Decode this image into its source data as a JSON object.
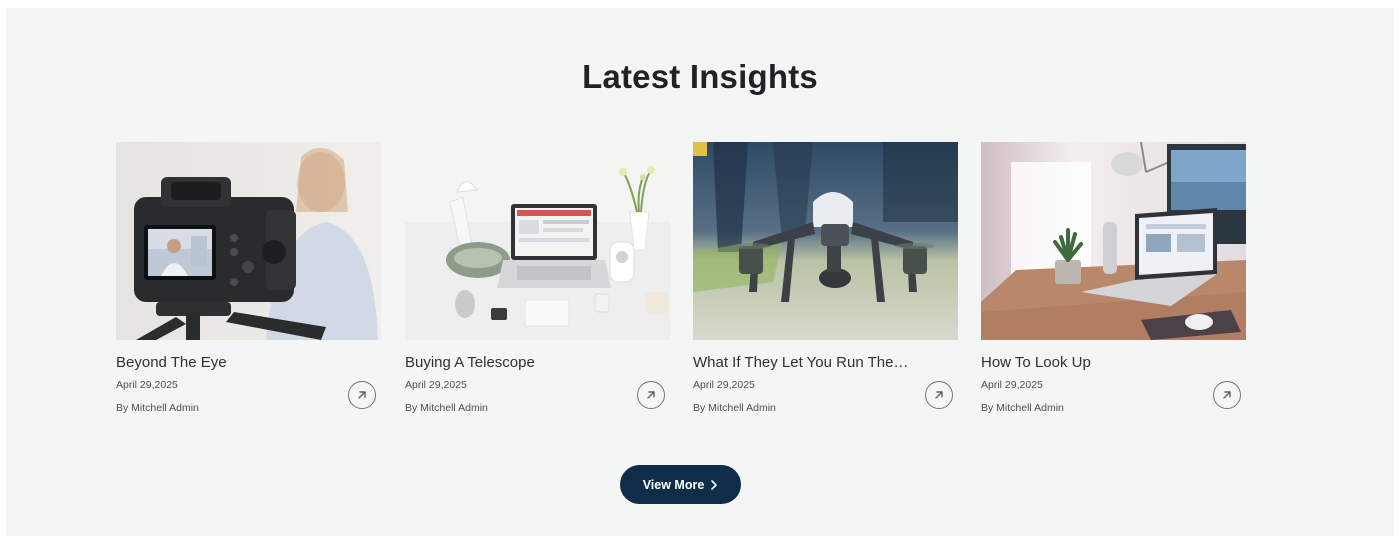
{
  "section": {
    "heading": "Latest Insights"
  },
  "posts": [
    {
      "title": "Beyond The Eye",
      "date": "April 29,2025",
      "author": "By Mitchell Admin",
      "image_icon": "camera-photo"
    },
    {
      "title": "Buying A Telescope",
      "date": "April 29,2025",
      "author": "By Mitchell Admin",
      "image_icon": "desk-laptop-photo"
    },
    {
      "title": "What If They Let You Run The…",
      "date": "April 29,2025",
      "author": "By Mitchell Admin",
      "image_icon": "drone-photo"
    },
    {
      "title": "How To Look Up",
      "date": "April 29,2025",
      "author": "By Mitchell Admin",
      "image_icon": "workspace-photo"
    }
  ],
  "view_more": {
    "label": "View More",
    "icon": "chevron-right-icon"
  },
  "colors": {
    "background": "#f4f6f6",
    "heading": "#1f2326",
    "button": "#0f2d48",
    "button_text": "#ffffff"
  }
}
